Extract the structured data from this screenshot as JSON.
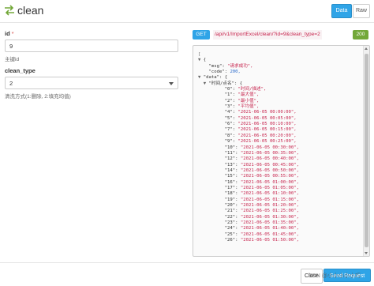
{
  "header": {
    "title": "clean",
    "swap_icon": "arrows-swap-icon",
    "tab_data": "Data",
    "tab_raw": "Raw"
  },
  "form": {
    "id_label": "id",
    "id_required": "*",
    "id_value": "9",
    "id_help": "主键id",
    "clean_type_label": "clean_type",
    "clean_type_value": "2",
    "clean_type_help": "清洗方式(1:删除, 2:填充均值)"
  },
  "request": {
    "method": "GET",
    "url": "/api/v1/ImportExcel/clean/?id=9&clean_type=2",
    "status": "200"
  },
  "response": {
    "lines": [
      {
        "t": "tog",
        "text": "["
      },
      {
        "t": "kv",
        "indent": 1,
        "tog": "▼",
        "key": "{"
      },
      {
        "t": "kv",
        "indent": 2,
        "key": "\"msg\": ",
        "str": "\"请求成功\","
      },
      {
        "t": "kv",
        "indent": 2,
        "key": "\"code\": ",
        "num": "200,"
      },
      {
        "t": "kv",
        "indent": 1,
        "tog": "▼",
        "key": "\"data\": {"
      },
      {
        "t": "kv",
        "indent": 2,
        "tog": "▼",
        "key": "\"时间/点名\": {"
      },
      {
        "t": "kv",
        "indent": 5,
        "key": "\"0\": ",
        "str": "\"时间/描述\","
      },
      {
        "t": "kv",
        "indent": 5,
        "key": "\"1\": ",
        "str": "\"最大值\","
      },
      {
        "t": "kv",
        "indent": 5,
        "key": "\"2\": ",
        "str": "\"最小值\","
      },
      {
        "t": "kv",
        "indent": 5,
        "key": "\"3\": ",
        "str": "\"平均值\","
      },
      {
        "t": "kv",
        "indent": 5,
        "key": "\"4\": ",
        "str": "\"2021-06-05 00:00:00\","
      },
      {
        "t": "kv",
        "indent": 5,
        "key": "\"5\": ",
        "str": "\"2021-06-05 00:05:00\","
      },
      {
        "t": "kv",
        "indent": 5,
        "key": "\"6\": ",
        "str": "\"2021-06-05 00:10:00\","
      },
      {
        "t": "kv",
        "indent": 5,
        "key": "\"7\": ",
        "str": "\"2021-06-05 00:15:00\","
      },
      {
        "t": "kv",
        "indent": 5,
        "key": "\"8\": ",
        "str": "\"2021-06-05 00:20:00\","
      },
      {
        "t": "kv",
        "indent": 5,
        "key": "\"9\": ",
        "str": "\"2021-06-05 00:25:00\","
      },
      {
        "t": "kv",
        "indent": 5,
        "key": "\"10\": ",
        "str": "\"2021-06-05 00:30:00\","
      },
      {
        "t": "kv",
        "indent": 5,
        "key": "\"11\": ",
        "str": "\"2021-06-05 00:35:00\","
      },
      {
        "t": "kv",
        "indent": 5,
        "key": "\"12\": ",
        "str": "\"2021-06-05 00:40:00\","
      },
      {
        "t": "kv",
        "indent": 5,
        "key": "\"13\": ",
        "str": "\"2021-06-05 00:45:00\","
      },
      {
        "t": "kv",
        "indent": 5,
        "key": "\"14\": ",
        "str": "\"2021-06-05 00:50:00\","
      },
      {
        "t": "kv",
        "indent": 5,
        "key": "\"15\": ",
        "str": "\"2021-06-05 00:55:00\","
      },
      {
        "t": "kv",
        "indent": 5,
        "key": "\"16\": ",
        "str": "\"2021-06-05 01:00:00\","
      },
      {
        "t": "kv",
        "indent": 5,
        "key": "\"17\": ",
        "str": "\"2021-06-05 01:05:00\","
      },
      {
        "t": "kv",
        "indent": 5,
        "key": "\"18\": ",
        "str": "\"2021-06-05 01:10:00\","
      },
      {
        "t": "kv",
        "indent": 5,
        "key": "\"19\": ",
        "str": "\"2021-06-05 01:15:00\","
      },
      {
        "t": "kv",
        "indent": 5,
        "key": "\"20\": ",
        "str": "\"2021-06-05 01:20:00\","
      },
      {
        "t": "kv",
        "indent": 5,
        "key": "\"21\": ",
        "str": "\"2021-06-05 01:25:00\","
      },
      {
        "t": "kv",
        "indent": 5,
        "key": "\"22\": ",
        "str": "\"2021-06-05 01:30:00\","
      },
      {
        "t": "kv",
        "indent": 5,
        "key": "\"23\": ",
        "str": "\"2021-06-05 01:35:00\","
      },
      {
        "t": "kv",
        "indent": 5,
        "key": "\"24\": ",
        "str": "\"2021-06-05 01:40:00\","
      },
      {
        "t": "kv",
        "indent": 5,
        "key": "\"25\": ",
        "str": "\"2021-06-05 01:45:00\","
      },
      {
        "t": "kv",
        "indent": 5,
        "key": "\"26\": ",
        "str": "\"2021-06-05 01:50:00\","
      }
    ]
  },
  "footer": {
    "close_label": "Close",
    "send_label": "Send Request",
    "watermark": "CSDN @小小小小小巧"
  },
  "colors": {
    "primary": "#2fa4e7",
    "success": "#73a839",
    "code_text": "#c7254e"
  }
}
